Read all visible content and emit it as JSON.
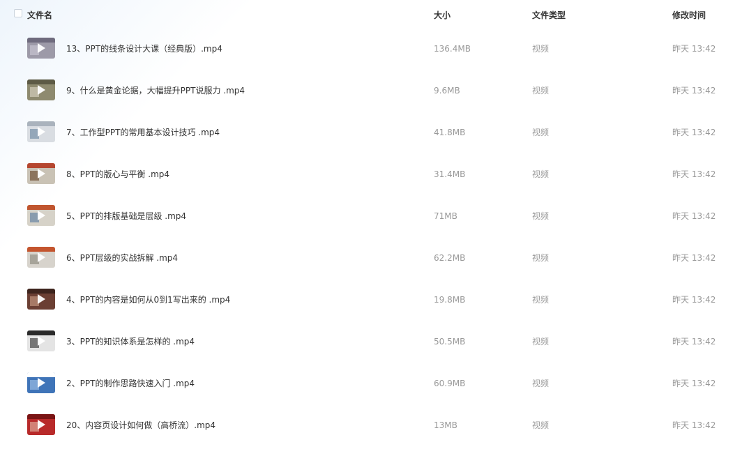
{
  "header": {
    "name_label": "文件名",
    "size_label": "大小",
    "type_label": "文件类型",
    "time_label": "修改时间"
  },
  "files": [
    {
      "name": "13、PPT的线条设计大课（经典版）.mp4",
      "size": "136.4MB",
      "type": "视频",
      "modified": "昨天 13:42",
      "thumb": {
        "bg": "#9d9aa8",
        "band": "#6f6b7e",
        "block": "#c9c6d3"
      }
    },
    {
      "name": "9、什么是黄金论据，大幅提升PPT说服力 .mp4",
      "size": "9.6MB",
      "type": "视频",
      "modified": "昨天 13:42",
      "thumb": {
        "bg": "#8e8a6f",
        "band": "#5d5a45",
        "block": "#d8d2c0"
      }
    },
    {
      "name": "7、工作型PPT的常用基本设计技巧 .mp4",
      "size": "41.8MB",
      "type": "视频",
      "modified": "昨天 13:42",
      "thumb": {
        "bg": "#d9dde2",
        "band": "#aab3bd",
        "block": "#6e8aa3"
      }
    },
    {
      "name": "8、PPT的版心与平衡 .mp4",
      "size": "31.4MB",
      "type": "视频",
      "modified": "昨天 13:42",
      "thumb": {
        "bg": "#c9c2b5",
        "band": "#b5462f",
        "block": "#6b4a2e"
      }
    },
    {
      "name": "5、PPT的排版基础是层级 .mp4",
      "size": "71MB",
      "type": "视频",
      "modified": "昨天 13:42",
      "thumb": {
        "bg": "#d6d2c8",
        "band": "#c0552f",
        "block": "#5f7fa0"
      }
    },
    {
      "name": "6、PPT层级的实战拆解 .mp4",
      "size": "62.2MB",
      "type": "视频",
      "modified": "昨天 13:42",
      "thumb": {
        "bg": "#d7d3cc",
        "band": "#c4552e",
        "block": "#8e8a80"
      }
    },
    {
      "name": "4、PPT的内容是如何从0到1写出来的 .mp4",
      "size": "19.8MB",
      "type": "视频",
      "modified": "昨天 13:42",
      "thumb": {
        "bg": "#6b3f33",
        "band": "#3d241d",
        "block": "#c79a83"
      }
    },
    {
      "name": "3、PPT的知识体系是怎样的 .mp4",
      "size": "50.5MB",
      "type": "视频",
      "modified": "昨天 13:42",
      "thumb": {
        "bg": "#e4e4e4",
        "band": "#2a2a2a",
        "block": "#3b3b3b"
      }
    },
    {
      "name": "2、PPT的制作思路快速入门 .mp4",
      "size": "60.9MB",
      "type": "视频",
      "modified": "昨天 13:42",
      "thumb": {
        "bg": "#3f74b8",
        "band": "#ffffff",
        "block": "#9fc2e6"
      }
    },
    {
      "name": "20、内容页设计如何做（高桥流）.mp4",
      "size": "13MB",
      "type": "视频",
      "modified": "昨天 13:42",
      "thumb": {
        "bg": "#b82a2a",
        "band": "#7a1414",
        "block": "#e0b0a0"
      }
    }
  ]
}
